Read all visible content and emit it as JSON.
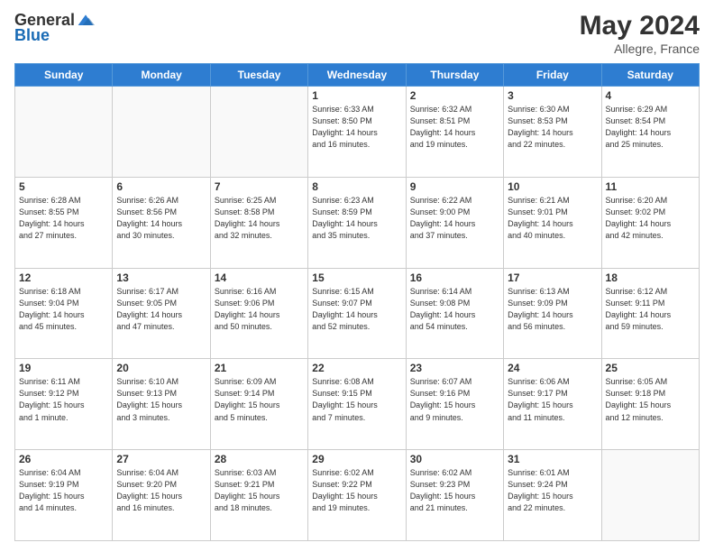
{
  "header": {
    "logo_general": "General",
    "logo_blue": "Blue",
    "month_title": "May 2024",
    "location": "Allegre, France"
  },
  "weekdays": [
    "Sunday",
    "Monday",
    "Tuesday",
    "Wednesday",
    "Thursday",
    "Friday",
    "Saturday"
  ],
  "weeks": [
    [
      {
        "day": "",
        "info": ""
      },
      {
        "day": "",
        "info": ""
      },
      {
        "day": "",
        "info": ""
      },
      {
        "day": "1",
        "info": "Sunrise: 6:33 AM\nSunset: 8:50 PM\nDaylight: 14 hours\nand 16 minutes."
      },
      {
        "day": "2",
        "info": "Sunrise: 6:32 AM\nSunset: 8:51 PM\nDaylight: 14 hours\nand 19 minutes."
      },
      {
        "day": "3",
        "info": "Sunrise: 6:30 AM\nSunset: 8:53 PM\nDaylight: 14 hours\nand 22 minutes."
      },
      {
        "day": "4",
        "info": "Sunrise: 6:29 AM\nSunset: 8:54 PM\nDaylight: 14 hours\nand 25 minutes."
      }
    ],
    [
      {
        "day": "5",
        "info": "Sunrise: 6:28 AM\nSunset: 8:55 PM\nDaylight: 14 hours\nand 27 minutes."
      },
      {
        "day": "6",
        "info": "Sunrise: 6:26 AM\nSunset: 8:56 PM\nDaylight: 14 hours\nand 30 minutes."
      },
      {
        "day": "7",
        "info": "Sunrise: 6:25 AM\nSunset: 8:58 PM\nDaylight: 14 hours\nand 32 minutes."
      },
      {
        "day": "8",
        "info": "Sunrise: 6:23 AM\nSunset: 8:59 PM\nDaylight: 14 hours\nand 35 minutes."
      },
      {
        "day": "9",
        "info": "Sunrise: 6:22 AM\nSunset: 9:00 PM\nDaylight: 14 hours\nand 37 minutes."
      },
      {
        "day": "10",
        "info": "Sunrise: 6:21 AM\nSunset: 9:01 PM\nDaylight: 14 hours\nand 40 minutes."
      },
      {
        "day": "11",
        "info": "Sunrise: 6:20 AM\nSunset: 9:02 PM\nDaylight: 14 hours\nand 42 minutes."
      }
    ],
    [
      {
        "day": "12",
        "info": "Sunrise: 6:18 AM\nSunset: 9:04 PM\nDaylight: 14 hours\nand 45 minutes."
      },
      {
        "day": "13",
        "info": "Sunrise: 6:17 AM\nSunset: 9:05 PM\nDaylight: 14 hours\nand 47 minutes."
      },
      {
        "day": "14",
        "info": "Sunrise: 6:16 AM\nSunset: 9:06 PM\nDaylight: 14 hours\nand 50 minutes."
      },
      {
        "day": "15",
        "info": "Sunrise: 6:15 AM\nSunset: 9:07 PM\nDaylight: 14 hours\nand 52 minutes."
      },
      {
        "day": "16",
        "info": "Sunrise: 6:14 AM\nSunset: 9:08 PM\nDaylight: 14 hours\nand 54 minutes."
      },
      {
        "day": "17",
        "info": "Sunrise: 6:13 AM\nSunset: 9:09 PM\nDaylight: 14 hours\nand 56 minutes."
      },
      {
        "day": "18",
        "info": "Sunrise: 6:12 AM\nSunset: 9:11 PM\nDaylight: 14 hours\nand 59 minutes."
      }
    ],
    [
      {
        "day": "19",
        "info": "Sunrise: 6:11 AM\nSunset: 9:12 PM\nDaylight: 15 hours\nand 1 minute."
      },
      {
        "day": "20",
        "info": "Sunrise: 6:10 AM\nSunset: 9:13 PM\nDaylight: 15 hours\nand 3 minutes."
      },
      {
        "day": "21",
        "info": "Sunrise: 6:09 AM\nSunset: 9:14 PM\nDaylight: 15 hours\nand 5 minutes."
      },
      {
        "day": "22",
        "info": "Sunrise: 6:08 AM\nSunset: 9:15 PM\nDaylight: 15 hours\nand 7 minutes."
      },
      {
        "day": "23",
        "info": "Sunrise: 6:07 AM\nSunset: 9:16 PM\nDaylight: 15 hours\nand 9 minutes."
      },
      {
        "day": "24",
        "info": "Sunrise: 6:06 AM\nSunset: 9:17 PM\nDaylight: 15 hours\nand 11 minutes."
      },
      {
        "day": "25",
        "info": "Sunrise: 6:05 AM\nSunset: 9:18 PM\nDaylight: 15 hours\nand 12 minutes."
      }
    ],
    [
      {
        "day": "26",
        "info": "Sunrise: 6:04 AM\nSunset: 9:19 PM\nDaylight: 15 hours\nand 14 minutes."
      },
      {
        "day": "27",
        "info": "Sunrise: 6:04 AM\nSunset: 9:20 PM\nDaylight: 15 hours\nand 16 minutes."
      },
      {
        "day": "28",
        "info": "Sunrise: 6:03 AM\nSunset: 9:21 PM\nDaylight: 15 hours\nand 18 minutes."
      },
      {
        "day": "29",
        "info": "Sunrise: 6:02 AM\nSunset: 9:22 PM\nDaylight: 15 hours\nand 19 minutes."
      },
      {
        "day": "30",
        "info": "Sunrise: 6:02 AM\nSunset: 9:23 PM\nDaylight: 15 hours\nand 21 minutes."
      },
      {
        "day": "31",
        "info": "Sunrise: 6:01 AM\nSunset: 9:24 PM\nDaylight: 15 hours\nand 22 minutes."
      },
      {
        "day": "",
        "info": ""
      }
    ]
  ]
}
